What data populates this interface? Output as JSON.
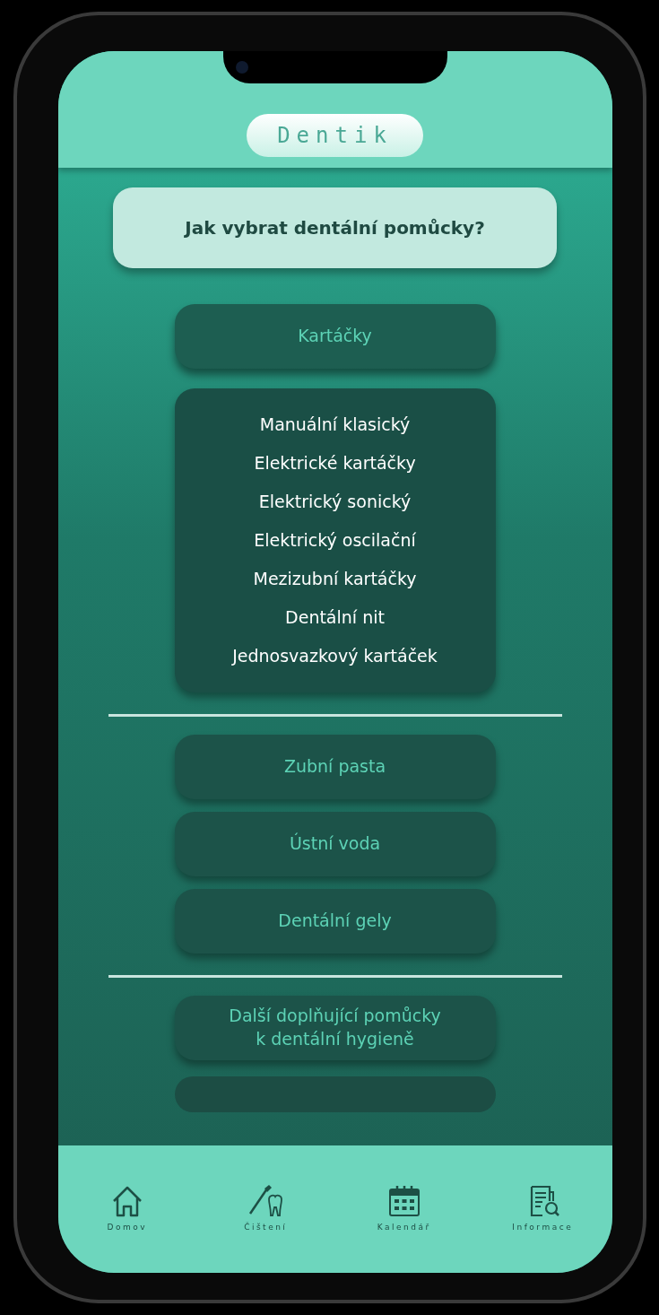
{
  "app_title": "Dentik",
  "question": "Jak vybrat dentální pomůcky?",
  "sections": [
    {
      "items": [
        {
          "label": "Kartáčky",
          "expanded": true,
          "children": [
            "Manuální klasický",
            "Elektrické kartáčky",
            "Elektrický sonický",
            "Elektrický oscilační",
            "Mezizubní kartáčky",
            "Dentální nit",
            "Jednosvazkový kartáček"
          ]
        }
      ]
    },
    {
      "items": [
        {
          "label": "Zubní pasta",
          "expanded": false
        },
        {
          "label": "Ústní voda",
          "expanded": false
        },
        {
          "label": "Dentální gely",
          "expanded": false
        }
      ]
    },
    {
      "items": [
        {
          "label": "Další doplňující pomůcky\nk dentální hygieně",
          "expanded": false
        }
      ]
    }
  ],
  "nav": [
    {
      "label": "Domov",
      "kind": "home"
    },
    {
      "label": "Čištení",
      "kind": "brush"
    },
    {
      "label": "Kalendář",
      "kind": "calendar"
    },
    {
      "label": "Informace",
      "kind": "info"
    }
  ]
}
